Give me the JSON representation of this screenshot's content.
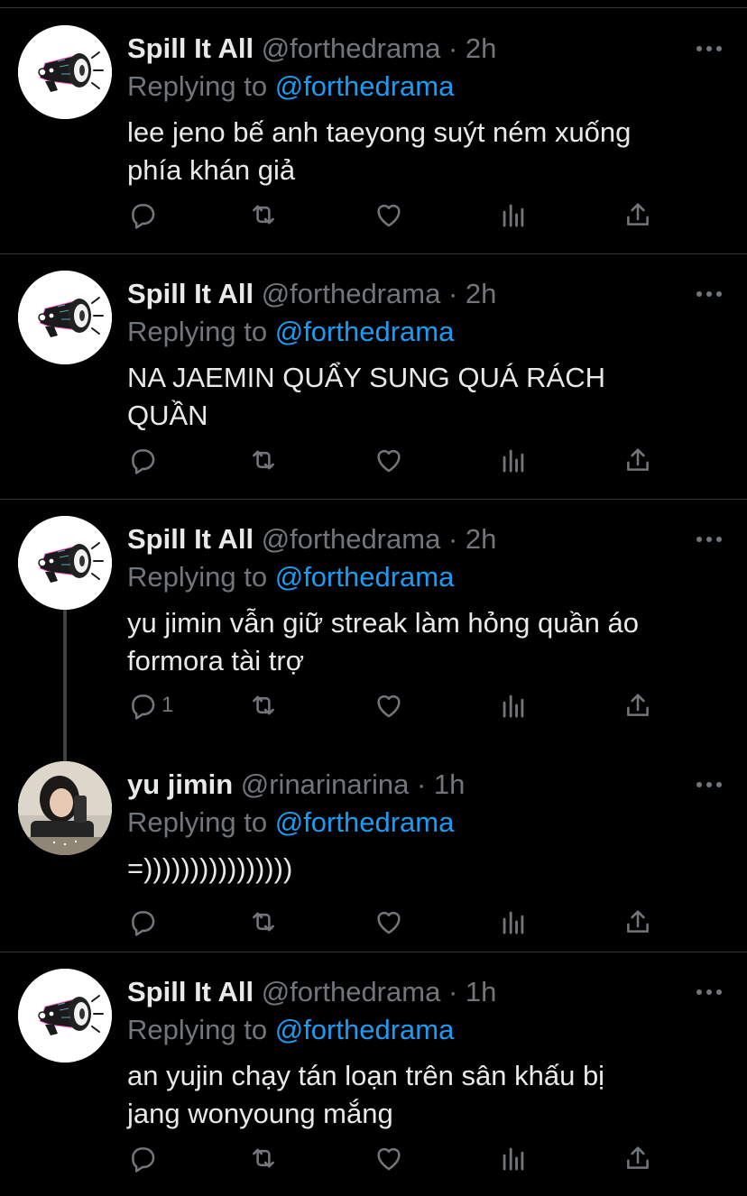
{
  "colors": {
    "background": "#000000",
    "text": "#e7e9ea",
    "muted": "#71767b",
    "link": "#1d9bf0",
    "divider": "#2f3336"
  },
  "tweets": [
    {
      "name": "Spill It All",
      "handle": "@forthedrama",
      "dot": "·",
      "time": "2h",
      "replying_prefix": "Replying to",
      "replying_to": "@forthedrama",
      "text": "lee jeno bế anh taeyong suýt ném xuống\nphía khán giả",
      "reply_count": "",
      "avatar": "megaphone-avatar"
    },
    {
      "name": "Spill It All",
      "handle": "@forthedrama",
      "dot": "·",
      "time": "2h",
      "replying_prefix": "Replying to",
      "replying_to": "@forthedrama",
      "text": "NA JAEMIN QUẨY SUNG QUÁ RÁCH\nQUẦN",
      "reply_count": "",
      "avatar": "megaphone-avatar"
    },
    {
      "name": "Spill It All",
      "handle": "@forthedrama",
      "dot": "·",
      "time": "2h",
      "replying_prefix": "Replying to",
      "replying_to": "@forthedrama",
      "text": "yu jimin vẫn giữ streak làm hỏng quần áo\nformora tài trợ",
      "reply_count": "1",
      "avatar": "megaphone-avatar"
    },
    {
      "name": "yu jimin",
      "handle": "@rinarinarina",
      "dot": "·",
      "time": "1h",
      "replying_prefix": "Replying to",
      "replying_to": "@forthedrama",
      "text": "=))))))))))))))))",
      "reply_count": "",
      "avatar": "photo-avatar"
    },
    {
      "name": "Spill It All",
      "handle": "@forthedrama",
      "dot": "·",
      "time": "1h",
      "replying_prefix": "Replying to",
      "replying_to": "@forthedrama",
      "text": "an yujin chạy tán loạn trên sân khấu bị\njang wonyoung mắng",
      "reply_count": "",
      "avatar": "megaphone-avatar"
    }
  ]
}
